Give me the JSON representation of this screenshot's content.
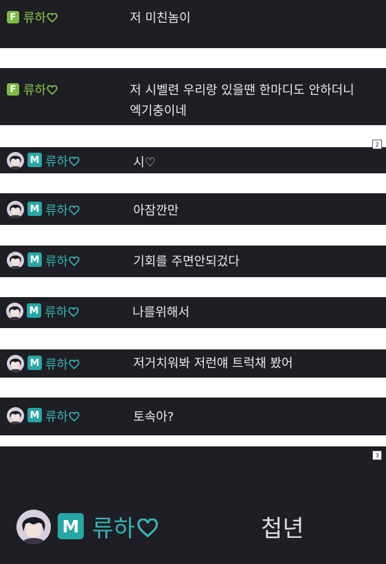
{
  "colors": {
    "bar_background": "#1e1f24",
    "female_accent": "#7dbb45",
    "male_accent": "#27a6a6",
    "message_text": "#e9e9ec"
  },
  "page_markers": [
    "2",
    "3"
  ],
  "messages": [
    {
      "badge": "F",
      "username": "류하",
      "heart_icon": "heart-outline-icon",
      "avatar": false,
      "text": "저 미친놈이"
    },
    {
      "badge": "F",
      "username": "류하",
      "heart_icon": "heart-outline-icon",
      "avatar": false,
      "text_lines": [
        "저 시벨련 우리랑 있을땐 한마디도 안하더니",
        "엑기충이네"
      ]
    },
    {
      "badge": "M",
      "username": "류하",
      "heart_icon": "heart-outline-icon",
      "avatar": true,
      "text": "시♡"
    },
    {
      "badge": "M",
      "username": "류하",
      "heart_icon": "heart-outline-icon",
      "avatar": true,
      "text": "아잠깐만"
    },
    {
      "badge": "M",
      "username": "류하",
      "heart_icon": "heart-outline-icon",
      "avatar": true,
      "text": "기회를 주면안되겄다"
    },
    {
      "badge": "M",
      "username": "류하",
      "heart_icon": "heart-outline-icon",
      "avatar": true,
      "text": "나를위해서"
    },
    {
      "badge": "M",
      "username": "류하",
      "heart_icon": "heart-outline-icon",
      "avatar": true,
      "text": "저거치워봐 저런얘 트럭채 봤어"
    },
    {
      "badge": "M",
      "username": "류하",
      "heart_icon": "heart-outline-icon",
      "avatar": true,
      "text": "토속아?"
    },
    {
      "badge": "M",
      "username": "류하",
      "heart_icon": "heart-outline-icon",
      "avatar": true,
      "text": "첩년"
    }
  ]
}
